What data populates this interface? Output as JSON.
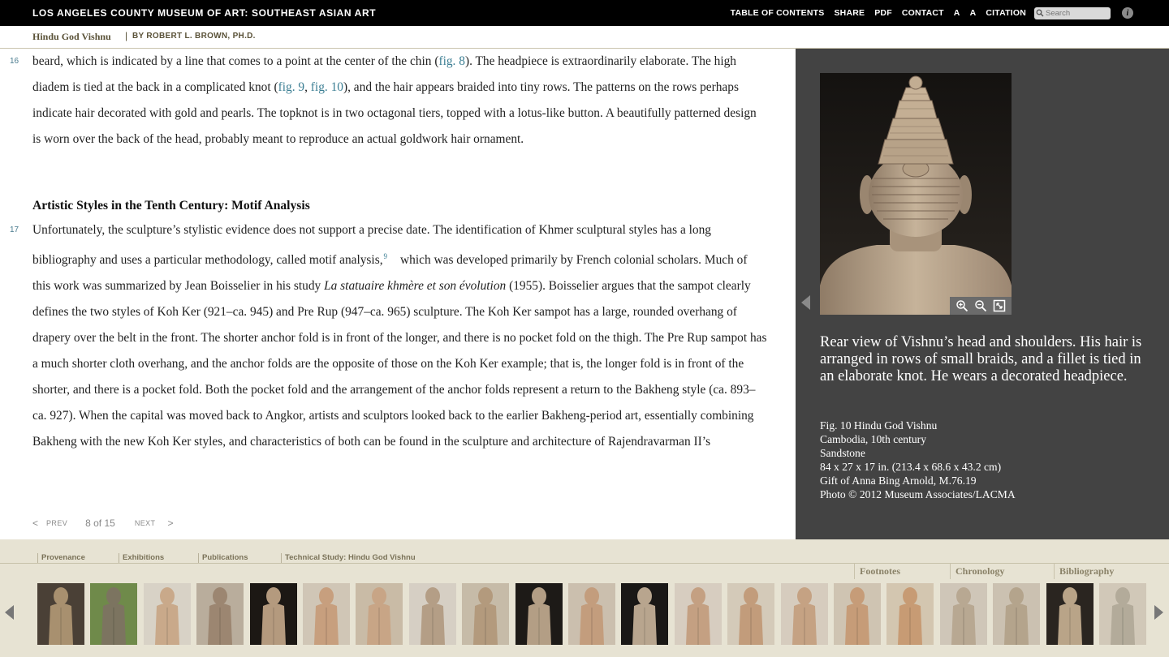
{
  "header": {
    "site_title": "LOS ANGELES COUNTY MUSEUM OF ART: SOUTHEAST ASIAN ART",
    "nav": [
      "TABLE OF CONTENTS",
      "SHARE",
      "PDF",
      "CONTACT",
      "A",
      "A",
      "CITATION"
    ],
    "search_placeholder": "Search",
    "info_icon": "info-icon"
  },
  "subheader": {
    "title": "Hindu God Vishnu",
    "separator": "|",
    "author": "BY ROBERT L. BROWN, PH.D."
  },
  "content": {
    "p16": {
      "num": "16",
      "t1": "beard, which is indicated by a line that comes to a point at the center of the chin (",
      "l1": "fig. 8",
      "t2": "). The headpiece is extraordinarily elaborate. The high diadem is tied at the back in a complicated knot (",
      "l2": "fig. 9",
      "t3": ", ",
      "l3": "fig. 10",
      "t4": "), and the hair appears braided into tiny rows. The patterns on the rows perhaps indicate hair decorated with gold and pearls. The topknot is in two octagonal tiers, topped with a lotus-like button. A beautifully patterned design is worn over the back of the head, probably meant to reproduce an actual goldwork hair ornament."
    },
    "heading": "Artistic Styles in the Tenth Century: Motif Analysis",
    "p17": {
      "num": "17",
      "t1": "Unfortunately, the sculpture’s stylistic evidence does not support a precise date. The identification of Khmer sculptural styles has a long bibliography and uses a particular methodology, called motif analysis,",
      "fn": "9",
      "t2": "which was developed primarily by French colonial scholars. Much of this work was summarized by Jean Boisselier in his study ",
      "em": "La statuaire khmère et son évolution",
      "t3": " (1955). Boisselier argues that the sampot clearly defines the two styles of Koh Ker (921–ca. 945) and Pre Rup (947–ca. 965) sculpture. The Koh Ker sampot has a large, rounded overhang of drapery over the belt in the front. The shorter anchor fold is in front of the longer, and there is no pocket fold on the thigh. The Pre Rup sampot has a much shorter cloth overhang, and the anchor folds are the opposite of those on the Koh Ker example; that is, the longer fold is in front of the shorter, and there is a pocket fold. Both the pocket fold and the arrangement of the anchor folds represent a return to the Bakheng style (ca. 893–ca. 927). When the capital was moved back to Angkor, artists and sculptors looked back to the earlier Bakheng-period art, essentially combining Bakheng with the new Koh Ker styles, and characteristics of both can be found in the sculpture and architecture of Rajendravarman II’s"
    }
  },
  "pager": {
    "prev_arrow": "<",
    "prev": "PREV",
    "count": "8 of 15",
    "next": "NEXT",
    "next_arrow": ">"
  },
  "figure": {
    "caption": "Rear view of Vishnu’s head and shoulders. His hair is arranged in rows of small braids, and a fillet is tied in an elaborate knot. He wears a decorated headpiece.",
    "credit_lines": [
      "Fig. 10 Hindu God Vishnu",
      "Cambodia, 10th century",
      "Sandstone",
      "84 x 27 x 17 in. (213.4 x 68.6 x 43.2 cm)",
      "Gift of Anna Bing Arnold, M.76.19",
      "Photo © 2012 Museum Associates/LACMA"
    ],
    "zoom_icons": [
      "zoom-in-icon",
      "zoom-out-icon",
      "fullscreen-icon"
    ]
  },
  "bottom": {
    "tabs": [
      "Provenance",
      "Exhibitions",
      "Publications",
      "Technical Study: Hindu God Vishnu"
    ],
    "right_tabs": [
      "Footnotes",
      "Chronology",
      "Bibliography"
    ],
    "thumbnail_count": 21
  },
  "colors": {
    "link": "#3b7e93",
    "panel": "#434343",
    "bottom_bg": "#e7e3d3",
    "topbar": "#000000"
  }
}
